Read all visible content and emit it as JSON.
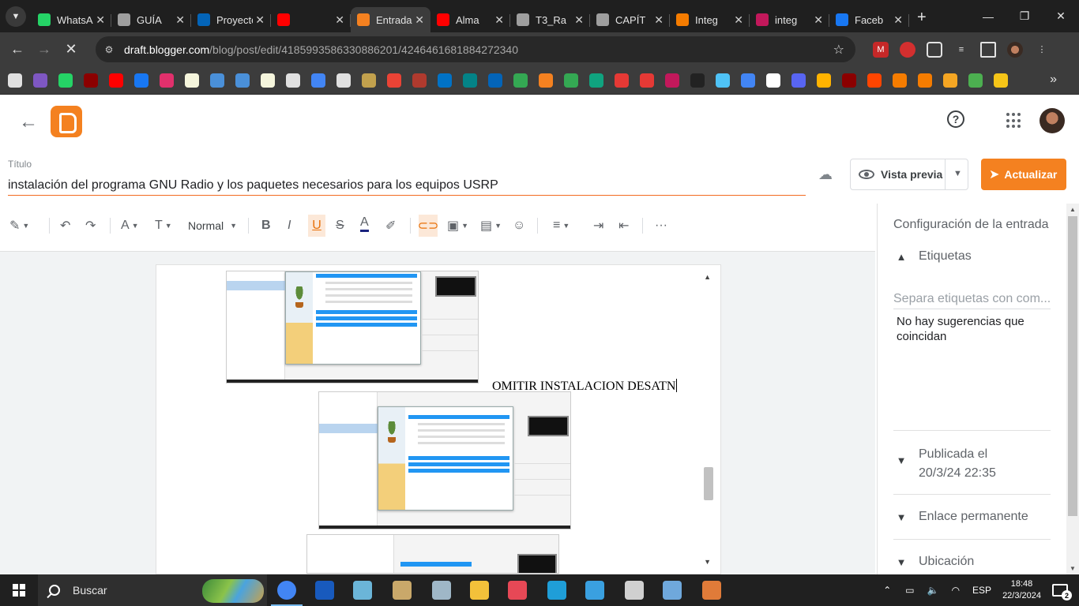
{
  "browser": {
    "tabs": [
      {
        "label": "WhatsApp",
        "icon": "whatsapp-icon",
        "color": "#25d366",
        "active": false
      },
      {
        "label": "GUÍA",
        "icon": "globe-icon",
        "color": "#9e9e9e",
        "active": false
      },
      {
        "label": "Proyecto",
        "icon": "onedrive-icon",
        "color": "#0364b8",
        "active": false
      },
      {
        "label": "",
        "icon": "youtube-icon",
        "color": "#ff0000",
        "active": false
      },
      {
        "label": "Entrada",
        "icon": "blogger-icon",
        "color": "#f48120",
        "active": true
      },
      {
        "label": "Alma",
        "icon": "youtube-icon",
        "color": "#ff0000",
        "active": false
      },
      {
        "label": "T3_Ra",
        "icon": "globe-icon",
        "color": "#9e9e9e",
        "active": false
      },
      {
        "label": "CAPÍT",
        "icon": "globe-icon",
        "color": "#9e9e9e",
        "active": false
      },
      {
        "label": "Integ",
        "icon": "gear-sun-icon",
        "color": "#f57c00",
        "active": false
      },
      {
        "label": "integ",
        "icon": "symbolab-icon",
        "color": "#c2185b",
        "active": false
      },
      {
        "label": "Faceb",
        "icon": "facebook-icon",
        "color": "#1877f2",
        "active": false
      }
    ],
    "url_host": "draft.blogger.com",
    "url_path": "/blog/post/edit/4185993586330886201/4246461681884272340",
    "bookmark_colors": [
      "#e0e0e0",
      "#7e57c2",
      "#25d366",
      "#8b0000",
      "#ff0000",
      "#1877f2",
      "#e1306c",
      "#f5f5dc",
      "#4a90d9",
      "#4a90d9",
      "#f5f5dc",
      "#e0e0e0",
      "#4285f4",
      "#e0e0e0",
      "#c2a14d",
      "#ea4335",
      "#b03a2e",
      "#0072c6",
      "#038387",
      "#0364b8",
      "#34a853",
      "#f48120",
      "#34a853",
      "#10a37f",
      "#e53935",
      "#e53935",
      "#c2185b",
      "#222222",
      "#4fc3f7",
      "#4285f4",
      "#ffffff",
      "#5865f2",
      "#ffb300",
      "#8b0000",
      "#ff4500",
      "#f57c00",
      "#f57c00",
      "#f5a623",
      "#4caf50",
      "#f5c518"
    ]
  },
  "blogger": {
    "title_label": "Título",
    "title_value": "instalación del programa GNU Radio y los paquetes necesarios para los equipos USRP",
    "preview_label": "Vista previa",
    "update_label": "Actualizar",
    "format_label": "Normal",
    "doc_text": "OMITIR INSTALACION DESATN",
    "accent": "#f48120",
    "sidebar": {
      "title": "Configuración de la entrada",
      "labels_section": "Etiquetas",
      "labels_placeholder": "Separa etiquetas con com...",
      "no_suggestions": "No hay sugerencias que coincidan",
      "published_label": "Publicada el",
      "published_date": "20/3/24 22:35",
      "permalink": "Enlace permanente",
      "location": "Ubicación"
    }
  },
  "taskbar": {
    "search_label": "Buscar",
    "language": "ESP",
    "time": "18:48",
    "date": "22/3/2024",
    "notifications": "2",
    "apps": [
      {
        "name": "chrome-app",
        "color": "#4285f4"
      },
      {
        "name": "word-app",
        "color": "#185abd"
      },
      {
        "name": "notes-app",
        "color": "#6bb5d8"
      },
      {
        "name": "paint-app",
        "color": "#c9a86a"
      },
      {
        "name": "photos-app",
        "color": "#9fb7c7"
      },
      {
        "name": "explorer-app",
        "color": "#f3c13a"
      },
      {
        "name": "media-app",
        "color": "#e74856"
      },
      {
        "name": "tool-app",
        "color": "#1f9ed8"
      },
      {
        "name": "remote-app",
        "color": "#3aa0e0"
      },
      {
        "name": "settings-app",
        "color": "#d0d0d0"
      },
      {
        "name": "virtualbox-app",
        "color": "#6fa8dc"
      },
      {
        "name": "matlab-app",
        "color": "#e07b39"
      }
    ]
  }
}
